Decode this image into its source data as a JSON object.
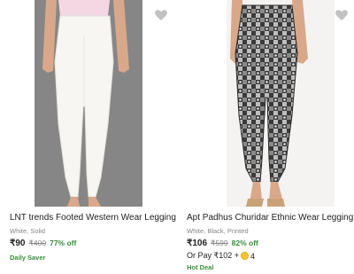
{
  "products": [
    {
      "title": "LNT trends Footed Western Wear Legging",
      "subtitle": "White, Solid",
      "price": "₹90",
      "mrp": "₹400",
      "discount": "77% off",
      "tag": "Daily Saver",
      "wishlist_icon": "heart-icon",
      "image": "white-legging-photo"
    },
    {
      "title": "Apt Padhus Churidar Ethnic Wear Legging",
      "subtitle": "White, Black, Printed",
      "price": "₹106",
      "mrp": "₹599",
      "discount": "82% off",
      "pay_prefix": "Or Pay ₹102 +",
      "pay_coins": "4",
      "tag": "Hot Deal",
      "wishlist_icon": "heart-icon",
      "image": "printed-legging-photo"
    }
  ],
  "colors": {
    "discount_green": "#388e3c",
    "muted_grey": "#878787",
    "heart_grey": "#c2c2c2"
  }
}
